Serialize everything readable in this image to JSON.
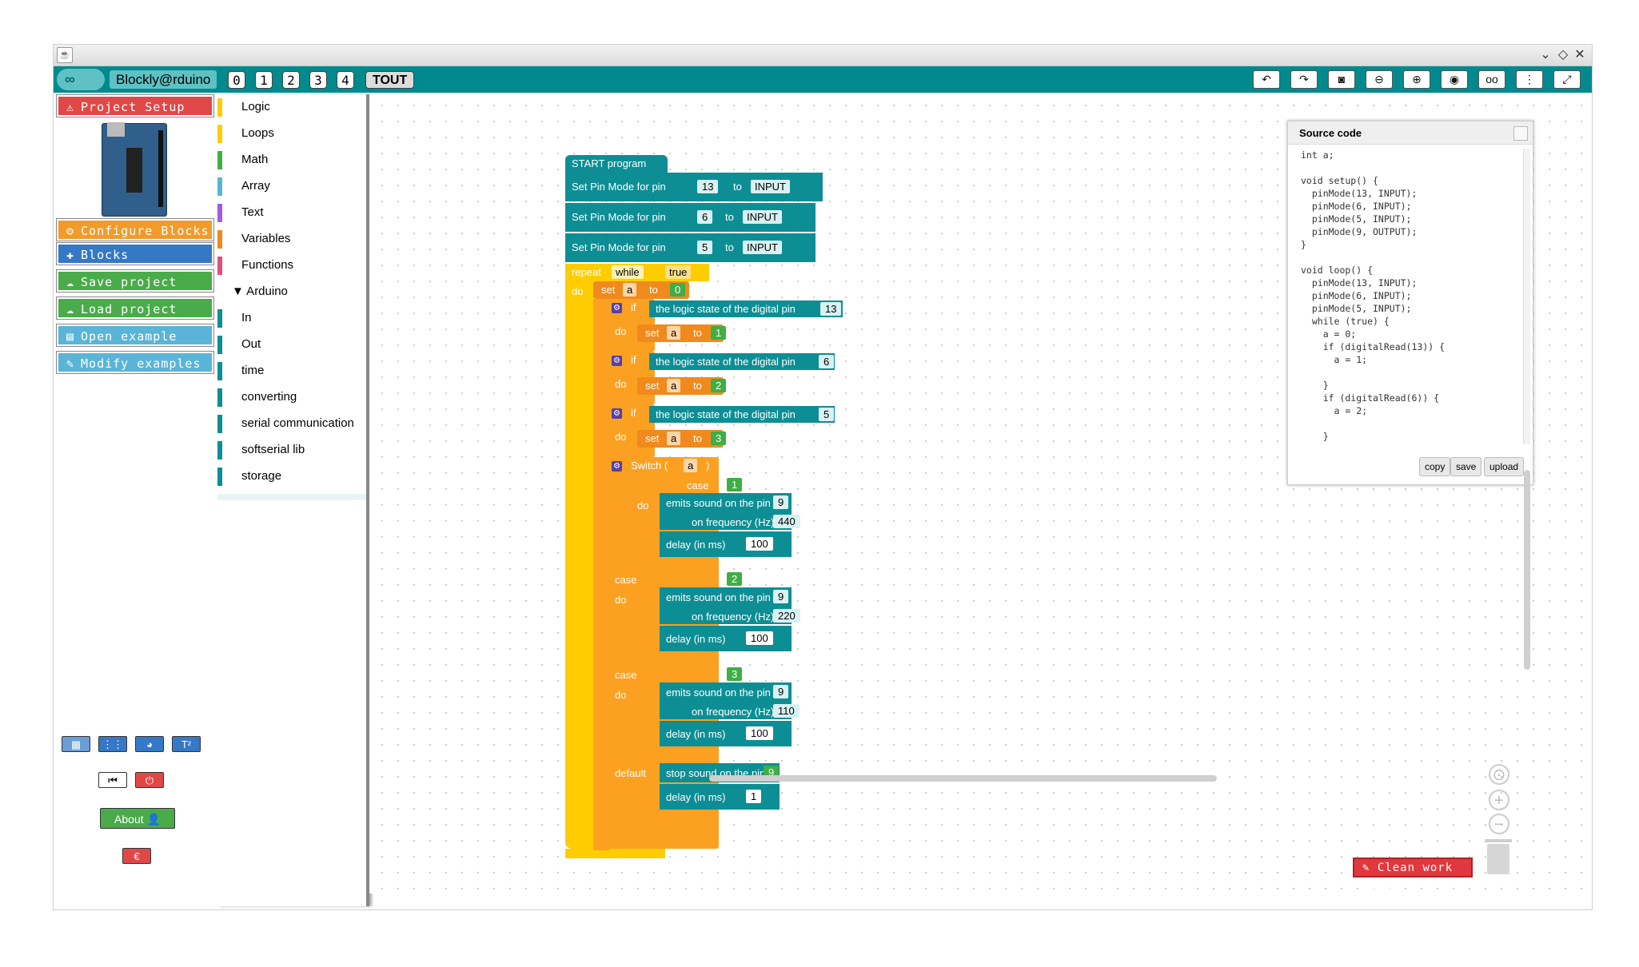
{
  "app": {
    "brand": "Blockly@rduino"
  },
  "toolbar": {
    "levels": [
      "0",
      "1",
      "2",
      "3",
      "4"
    ],
    "all_label": "TOUT",
    "tools": [
      "undo-icon",
      "redo-icon",
      "camera-icon",
      "zoom-out-icon",
      "zoom-in-icon",
      "eye-icon",
      "glasses-icon",
      "more-vertical-icon",
      "fullscreen-icon"
    ]
  },
  "sidebar": {
    "project_setup": "Project Setup",
    "configure_blocks": "Configure Blocks",
    "blocks": "Blocks",
    "save_project": "Save project",
    "load_project": "Load project",
    "open_example": "Open example",
    "modify_examples": "Modify examples",
    "about": "About",
    "currency": "€"
  },
  "toolbox": {
    "categories": [
      {
        "label": "Logic",
        "color": "#ffcc00"
      },
      {
        "label": "Loops",
        "color": "#ffcc00"
      },
      {
        "label": "Math",
        "color": "#3fae45"
      },
      {
        "label": "Array",
        "color": "#5ab4d8"
      },
      {
        "label": "Text",
        "color": "#a45be0"
      },
      {
        "label": "Variables",
        "color": "#f08a1c"
      },
      {
        "label": "Functions",
        "color": "#e0507a"
      },
      {
        "label": "▼ Arduino",
        "color": ""
      },
      {
        "label": "In",
        "color": "#0d8e95"
      },
      {
        "label": "Out",
        "color": "#0d8e95"
      },
      {
        "label": "time",
        "color": "#0d8e95"
      },
      {
        "label": "converting",
        "color": "#0d8e95"
      },
      {
        "label": "serial communication",
        "color": "#0d8e95"
      },
      {
        "label": "softserial lib",
        "color": "#0d8e95"
      },
      {
        "label": "storage",
        "color": "#0d8e95"
      }
    ]
  },
  "blocks": {
    "start": "START program",
    "pinmode_label": "Set Pin Mode for pin",
    "to": "to",
    "pinmodes": [
      {
        "pin": "13",
        "mode": "INPUT"
      },
      {
        "pin": "6",
        "mode": "INPUT"
      },
      {
        "pin": "5",
        "mode": "INPUT"
      }
    ],
    "repeat": "repeat",
    "while": "while",
    "true": "true",
    "do": "do",
    "set": "set",
    "var": "a",
    "set_value0": "0",
    "if": "if",
    "logic_state": "the logic state of the digital pin",
    "ifs": [
      {
        "pin": "13",
        "value": "1"
      },
      {
        "pin": "6",
        "value": "2"
      },
      {
        "pin": "5",
        "value": "3"
      }
    ],
    "switch": "Switch (",
    "switch_close": ")",
    "case": "case",
    "default": "default",
    "emits": "emits sound on the pin",
    "on_freq": "on frequency (Hz)",
    "delay": "delay (in ms)",
    "cases": [
      {
        "case": "1",
        "pin": "9",
        "freq": "440",
        "delay": "100"
      },
      {
        "case": "2",
        "pin": "9",
        "freq": "220",
        "delay": "100"
      },
      {
        "case": "3",
        "pin": "9",
        "freq": "110",
        "delay": "100"
      }
    ],
    "stop_sound": "stop sound on the pin",
    "stop_pin": "9",
    "default_delay": "1"
  },
  "source": {
    "title": "Source code",
    "code": "int a;\n\nvoid setup() {\n  pinMode(13, INPUT);\n  pinMode(6, INPUT);\n  pinMode(5, INPUT);\n  pinMode(9, OUTPUT);\n}\n\nvoid loop() {\n  pinMode(13, INPUT);\n  pinMode(6, INPUT);\n  pinMode(5, INPUT);\n  while (true) {\n    a = 0;\n    if (digitalRead(13)) {\n      a = 1;\n\n    }\n    if (digitalRead(6)) {\n      a = 2;\n\n    }",
    "copy": "copy",
    "save": "save",
    "upload": "upload"
  },
  "workspace": {
    "clean": "Clean work space"
  },
  "colors": {
    "teal": "#008a8e",
    "block_teal": "#0d8e95",
    "loop_yellow": "#ffcc00",
    "logic_orange": "#fca022"
  }
}
